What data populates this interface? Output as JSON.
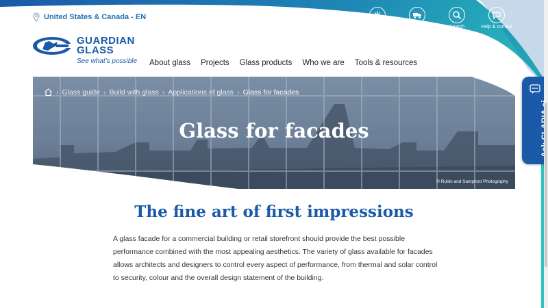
{
  "header": {
    "locale": "United States & Canada - EN",
    "brand_line1": "GUARDIAN",
    "brand_line2": "GLASS",
    "tagline": "See what's possible",
    "accent": "#1a5aa8",
    "teal": "#2cb7b5"
  },
  "utility_nav": [
    {
      "label": "Resource Hub",
      "icon": "resource-hub-icon"
    },
    {
      "label": "Commerce & Service Portal",
      "icon": "truck-icon"
    },
    {
      "label": "Search",
      "icon": "search-icon"
    },
    {
      "label": "Help & contact",
      "icon": "help-icon"
    }
  ],
  "main_nav": [
    "About glass",
    "Projects",
    "Glass products",
    "Who we are",
    "Tools & resources"
  ],
  "breadcrumb": [
    "Glass guide",
    "Build with glass",
    "Applications of glass",
    "Glass for facades"
  ],
  "hero": {
    "title": "Glass for facades",
    "credit": "© Rubin and Sampford Photography"
  },
  "claria": {
    "label": "Ask CLARIA ai"
  },
  "content": {
    "headline": "The fine art of first impressions",
    "paragraph": "A glass facade for a commercial building or retail storefront should provide the best possible performance combined with the most appealing aesthetics. The variety of glass available for facades allows architects and designers to control every aspect of performance, from thermal and solar control to security, colour and the overall design statement of the building."
  }
}
